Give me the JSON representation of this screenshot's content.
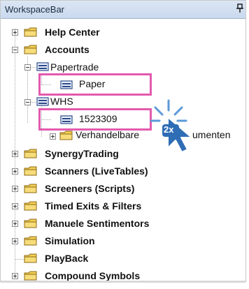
{
  "panel": {
    "title": "WorkspaceBar"
  },
  "tree": {
    "help_center": "Help Center",
    "accounts": "Accounts",
    "papertrade": "Papertrade",
    "paper": "Paper",
    "whs": "WHS",
    "account_1523309": "1523309",
    "verhandelbare_left": "Verhandelbare",
    "verhandelbare_right": "umenten",
    "synergy": "SynergyTrading",
    "scanners": "Scanners (LiveTables)",
    "screeners": "Screeners (Scripts)",
    "timed_exits": "Timed Exits & Filters",
    "manuele": "Manuele Sentimentors",
    "simulation": "Simulation",
    "playback": "PlayBack",
    "compound": "Compound Symbols"
  },
  "cursor": {
    "badge": "2x"
  },
  "colors": {
    "highlight": "#e35aae",
    "folder": "#f2cf55",
    "cursor": "#2f6db5"
  }
}
